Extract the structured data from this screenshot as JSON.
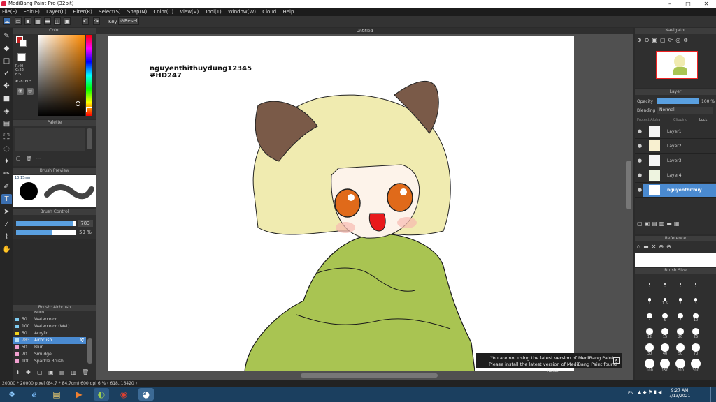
{
  "window": {
    "title": "MediBang Paint Pro (32bit)",
    "minimize": "–",
    "maximize": "□",
    "close": "✕"
  },
  "menu": [
    "File(F)",
    "Edit(E)",
    "Layer(L)",
    "Filter(R)",
    "Select(S)",
    "Snap(N)",
    "Color(C)",
    "View(V)",
    "Tool(T)",
    "Window(W)",
    "Cloud",
    "Help"
  ],
  "toolbar": {
    "key_label": "Key",
    "reset_label": "Reset"
  },
  "color_panel": {
    "title": "Color",
    "r": "R:40",
    "g": "G:22",
    "b": "B:5",
    "hex": "#281605",
    "picked_color": "#281605"
  },
  "palette_panel": {
    "title": "Palette",
    "dash": "---"
  },
  "brush_preview": {
    "title": "Brush Preview",
    "size": "13.15mm"
  },
  "brush_control": {
    "title": "Brush Control",
    "size_value": "783",
    "opacity_value": "59 %",
    "size_fraction": 0.95,
    "opacity_fraction": 0.59
  },
  "brush_list": {
    "title": "Brush: Airbrush",
    "items": [
      {
        "size": "50",
        "name": "Watercolor",
        "color": "#7ecbf0"
      },
      {
        "size": "100",
        "name": "Watercolor (Wet)",
        "color": "#7ecbf0"
      },
      {
        "size": "50",
        "name": "Acrylic",
        "color": "#f2d21a"
      },
      {
        "size": "783",
        "name": "Airbrush",
        "color": "#b8dff6"
      },
      {
        "size": "50",
        "name": "Blur",
        "color": "#f0a0d0"
      },
      {
        "size": "70",
        "name": "Smudge",
        "color": "#f0a0d0"
      },
      {
        "size": "100",
        "name": "Sparkle Brush",
        "color": "#f0a0d0"
      }
    ],
    "first_partial": "Burn"
  },
  "document": {
    "title": "Untitled",
    "watermark_line1": "nguyenthithuydung12345",
    "watermark_line2": "#HD247"
  },
  "navigator": {
    "title": "Navigator"
  },
  "layer_panel": {
    "title": "Layer",
    "opacity_label": "Opacity",
    "opacity_value": "100 %",
    "blending_label": "Blending",
    "blending_value": "Normal",
    "protect_alpha": "Protect Alpha",
    "clipping": "Clipping",
    "lock": "Lock",
    "layers": [
      "Layer1",
      "Layer2",
      "Layer3",
      "Layer4",
      "nguyenthithuy"
    ]
  },
  "reference_panel": {
    "title": "Reference"
  },
  "brush_size_panel": {
    "title": "Brush Size",
    "sizes": [
      "·",
      "·",
      "·",
      "·",
      "1",
      "1.5",
      "2",
      "3",
      "4",
      "5",
      "7",
      "10",
      "12",
      "15",
      "20",
      "25",
      "30",
      "40",
      "50",
      "70",
      "100",
      "150",
      "200",
      "300"
    ]
  },
  "toast": {
    "line1": "You are not using the latest version of MediBang Paint.",
    "line2": "Please install the latest version of MediBang Paint found here.",
    "close": "✕"
  },
  "status": {
    "text": "20000 * 20000 pixel  (84.7 * 84.7cm)  600 dpi  6 %  ( 618, 16420 )"
  },
  "taskbar": {
    "time": "9:27 AM",
    "date": "7/13/2021",
    "lang": "EN"
  }
}
